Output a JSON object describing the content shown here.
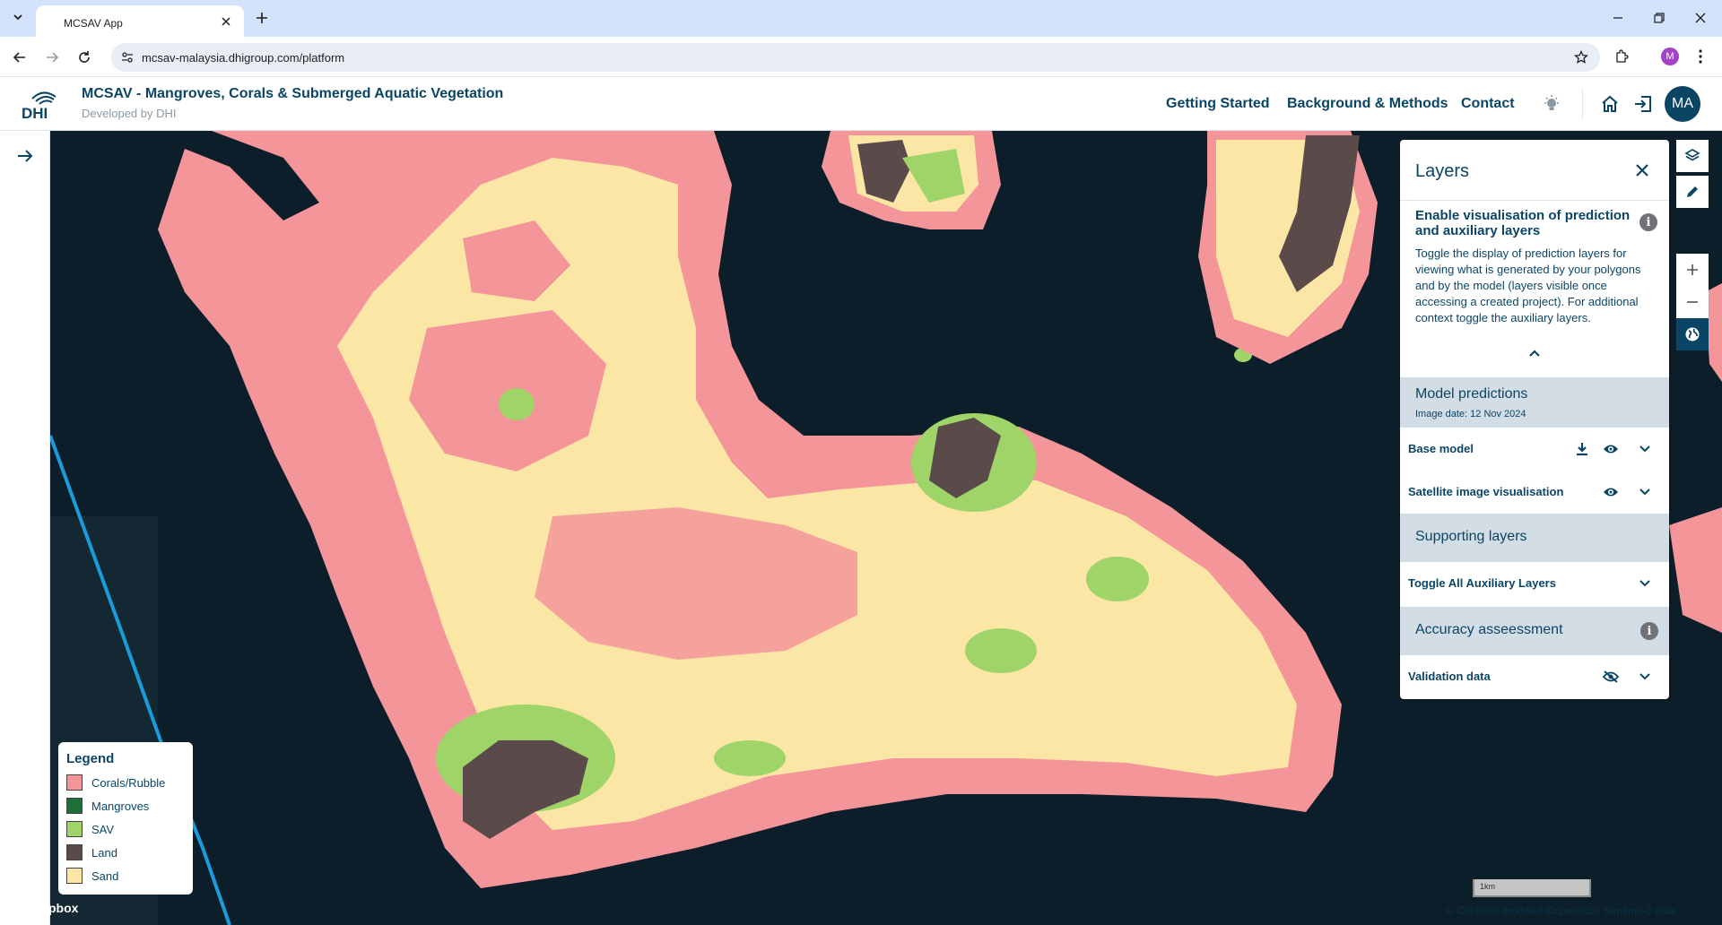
{
  "browser": {
    "tab_title": "MCSAV App",
    "url": "mcsav-malaysia.dhigroup.com/platform",
    "profile_initial": "M"
  },
  "header": {
    "logo_text": "DHI",
    "title": "MCSAV - Mangroves, Corals & Submerged Aquatic Vegetation",
    "subtitle": "Developed by DHI",
    "nav": [
      "Getting Started",
      "Background & Methods",
      "Contact"
    ],
    "user_initials": "MA"
  },
  "layers_panel": {
    "title": "Layers",
    "info_heading": "Enable visualisation of prediction and auxiliary layers",
    "info_text": "Toggle the display of prediction layers for viewing what is generated by your polygons and by the model (layers visible once accessing a created project). For additional context toggle the auxiliary layers.",
    "info_icon": "i",
    "model_predictions": {
      "title": "Model predictions",
      "image_date": "Image date: 12 Nov 2024"
    },
    "rows_model": [
      {
        "label": "Base model"
      },
      {
        "label": "Satellite image visualisation"
      }
    ],
    "supporting": {
      "title": "Supporting layers",
      "rows": [
        {
          "label": "Toggle All Auxiliary Layers"
        }
      ]
    },
    "accuracy": {
      "title": "Accuracy asseessment",
      "rows": [
        {
          "label": "Validation data"
        }
      ]
    }
  },
  "legend": {
    "title": "Legend",
    "items": [
      {
        "label": "Corals/Rubble",
        "color": "#f4959a"
      },
      {
        "label": "Mangroves",
        "color": "#1f6e3a"
      },
      {
        "label": "SAV",
        "color": "#9fd468"
      },
      {
        "label": "Land",
        "color": "#5b4a4a"
      },
      {
        "label": "Sand",
        "color": "#fbe6a6"
      }
    ]
  },
  "map": {
    "mapbox_mark": "pbox",
    "scale_label": "1km",
    "attribution": "© Contains modified Copernicus Sentinel-2 data"
  }
}
